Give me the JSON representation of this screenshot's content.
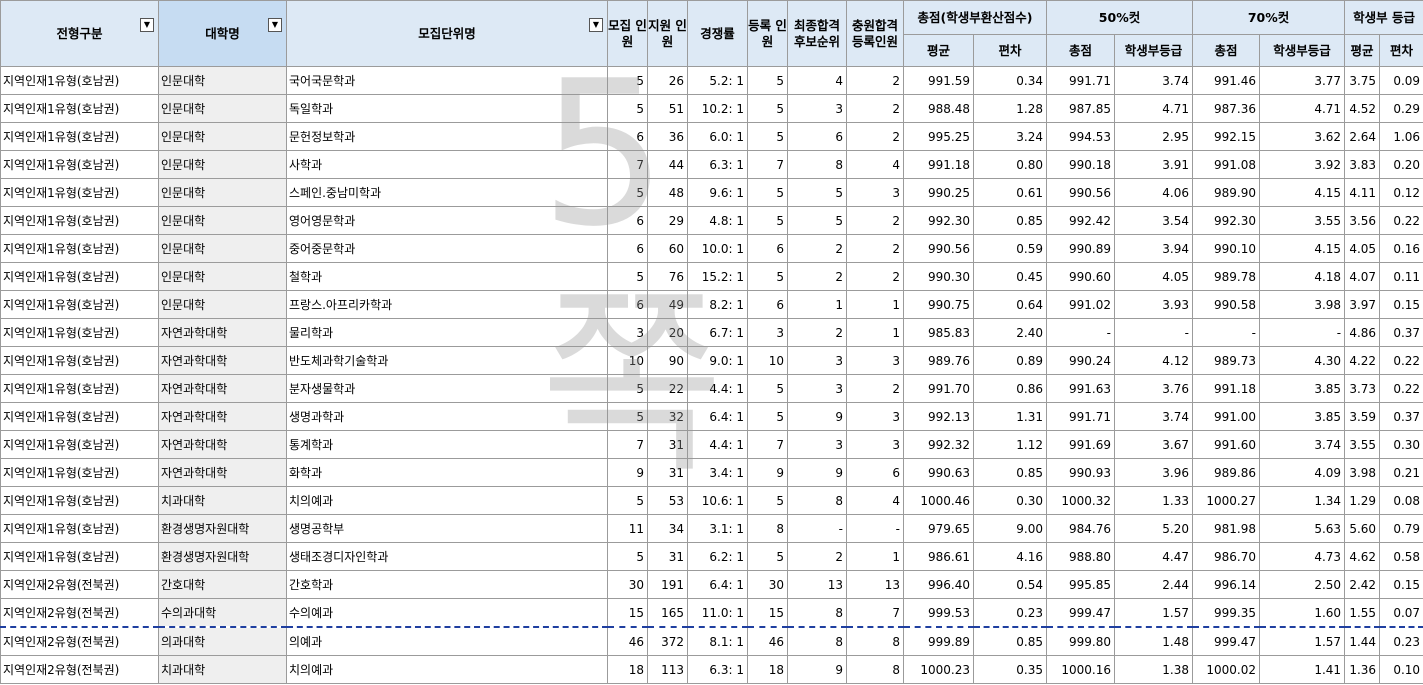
{
  "headers": {
    "type": "전형구분",
    "college": "대학명",
    "dept": "모집단위명",
    "recruit": "모집 인원",
    "apply": "지원 인원",
    "rate": "경쟁률",
    "enroll": "등록 인원",
    "final_wait": "최종합격 후보순위",
    "extra": "충원합격 등록인원",
    "score_group": "총점(학생부환산점수)",
    "avg": "평균",
    "dev": "편차",
    "cut50": "50%컷",
    "cut70": "70%컷",
    "total": "총점",
    "grade": "학생부등급",
    "grade_group": "학생부 등급",
    "g_avg": "평균",
    "g_dev": "편차"
  },
  "dropdown_icon": "▼",
  "watermark": "5 쪽",
  "rows": [
    [
      "지역인재1유형(호남권)",
      "인문대학",
      "국어국문학과",
      "5",
      "26",
      "5.2: 1",
      "5",
      "4",
      "2",
      "991.59",
      "0.34",
      "991.71",
      "3.74",
      "991.46",
      "3.77",
      "3.75",
      "0.09"
    ],
    [
      "지역인재1유형(호남권)",
      "인문대학",
      "독일학과",
      "5",
      "51",
      "10.2: 1",
      "5",
      "3",
      "2",
      "988.48",
      "1.28",
      "987.85",
      "4.71",
      "987.36",
      "4.71",
      "4.52",
      "0.29"
    ],
    [
      "지역인재1유형(호남권)",
      "인문대학",
      "문헌정보학과",
      "6",
      "36",
      "6.0: 1",
      "5",
      "6",
      "2",
      "995.25",
      "3.24",
      "994.53",
      "2.95",
      "992.15",
      "3.62",
      "2.64",
      "1.06"
    ],
    [
      "지역인재1유형(호남권)",
      "인문대학",
      "사학과",
      "7",
      "44",
      "6.3: 1",
      "7",
      "8",
      "4",
      "991.18",
      "0.80",
      "990.18",
      "3.91",
      "991.08",
      "3.92",
      "3.83",
      "0.20"
    ],
    [
      "지역인재1유형(호남권)",
      "인문대학",
      "스페인.중남미학과",
      "5",
      "48",
      "9.6: 1",
      "5",
      "5",
      "3",
      "990.25",
      "0.61",
      "990.56",
      "4.06",
      "989.90",
      "4.15",
      "4.11",
      "0.12"
    ],
    [
      "지역인재1유형(호남권)",
      "인문대학",
      "영어영문학과",
      "6",
      "29",
      "4.8: 1",
      "5",
      "5",
      "2",
      "992.30",
      "0.85",
      "992.42",
      "3.54",
      "992.30",
      "3.55",
      "3.56",
      "0.22"
    ],
    [
      "지역인재1유형(호남권)",
      "인문대학",
      "중어중문학과",
      "6",
      "60",
      "10.0: 1",
      "6",
      "2",
      "2",
      "990.56",
      "0.59",
      "990.89",
      "3.94",
      "990.10",
      "4.15",
      "4.05",
      "0.16"
    ],
    [
      "지역인재1유형(호남권)",
      "인문대학",
      "철학과",
      "5",
      "76",
      "15.2: 1",
      "5",
      "2",
      "2",
      "990.30",
      "0.45",
      "990.60",
      "4.05",
      "989.78",
      "4.18",
      "4.07",
      "0.11"
    ],
    [
      "지역인재1유형(호남권)",
      "인문대학",
      "프랑스.아프리카학과",
      "6",
      "49",
      "8.2: 1",
      "6",
      "1",
      "1",
      "990.75",
      "0.64",
      "991.02",
      "3.93",
      "990.58",
      "3.98",
      "3.97",
      "0.15"
    ],
    [
      "지역인재1유형(호남권)",
      "자연과학대학",
      "물리학과",
      "3",
      "20",
      "6.7: 1",
      "3",
      "2",
      "1",
      "985.83",
      "2.40",
      "-",
      "-",
      "-",
      "-",
      "4.86",
      "0.37"
    ],
    [
      "지역인재1유형(호남권)",
      "자연과학대학",
      "반도체과학기술학과",
      "10",
      "90",
      "9.0: 1",
      "10",
      "3",
      "3",
      "989.76",
      "0.89",
      "990.24",
      "4.12",
      "989.73",
      "4.30",
      "4.22",
      "0.22"
    ],
    [
      "지역인재1유형(호남권)",
      "자연과학대학",
      "분자생물학과",
      "5",
      "22",
      "4.4: 1",
      "5",
      "3",
      "2",
      "991.70",
      "0.86",
      "991.63",
      "3.76",
      "991.18",
      "3.85",
      "3.73",
      "0.22"
    ],
    [
      "지역인재1유형(호남권)",
      "자연과학대학",
      "생명과학과",
      "5",
      "32",
      "6.4: 1",
      "5",
      "9",
      "3",
      "992.13",
      "1.31",
      "991.71",
      "3.74",
      "991.00",
      "3.85",
      "3.59",
      "0.37"
    ],
    [
      "지역인재1유형(호남권)",
      "자연과학대학",
      "통계학과",
      "7",
      "31",
      "4.4: 1",
      "7",
      "3",
      "3",
      "992.32",
      "1.12",
      "991.69",
      "3.67",
      "991.60",
      "3.74",
      "3.55",
      "0.30"
    ],
    [
      "지역인재1유형(호남권)",
      "자연과학대학",
      "화학과",
      "9",
      "31",
      "3.4: 1",
      "9",
      "9",
      "6",
      "990.63",
      "0.85",
      "990.93",
      "3.96",
      "989.86",
      "4.09",
      "3.98",
      "0.21"
    ],
    [
      "지역인재1유형(호남권)",
      "치과대학",
      "치의예과",
      "5",
      "53",
      "10.6: 1",
      "5",
      "8",
      "4",
      "1000.46",
      "0.30",
      "1000.32",
      "1.33",
      "1000.27",
      "1.34",
      "1.29",
      "0.08"
    ],
    [
      "지역인재1유형(호남권)",
      "환경생명자원대학",
      "생명공학부",
      "11",
      "34",
      "3.1: 1",
      "8",
      "-",
      "-",
      "979.65",
      "9.00",
      "984.76",
      "5.20",
      "981.98",
      "5.63",
      "5.60",
      "0.79"
    ],
    [
      "지역인재1유형(호남권)",
      "환경생명자원대학",
      "생태조경디자인학과",
      "5",
      "31",
      "6.2: 1",
      "5",
      "2",
      "1",
      "986.61",
      "4.16",
      "988.80",
      "4.47",
      "986.70",
      "4.73",
      "4.62",
      "0.58"
    ],
    [
      "지역인재2유형(전북권)",
      "간호대학",
      "간호학과",
      "30",
      "191",
      "6.4: 1",
      "30",
      "13",
      "13",
      "996.40",
      "0.54",
      "995.85",
      "2.44",
      "996.14",
      "2.50",
      "2.42",
      "0.15"
    ],
    [
      "지역인재2유형(전북권)",
      "수의과대학",
      "수의예과",
      "15",
      "165",
      "11.0: 1",
      "15",
      "8",
      "7",
      "999.53",
      "0.23",
      "999.47",
      "1.57",
      "999.35",
      "1.60",
      "1.55",
      "0.07"
    ],
    [
      "지역인재2유형(전북권)",
      "의과대학",
      "의예과",
      "46",
      "372",
      "8.1: 1",
      "46",
      "8",
      "8",
      "999.89",
      "0.85",
      "999.80",
      "1.48",
      "999.47",
      "1.57",
      "1.44",
      "0.23"
    ],
    [
      "지역인재2유형(전북권)",
      "치과대학",
      "치의예과",
      "18",
      "113",
      "6.3: 1",
      "18",
      "9",
      "8",
      "1000.23",
      "0.35",
      "1000.16",
      "1.38",
      "1000.02",
      "1.41",
      "1.36",
      "0.10"
    ]
  ]
}
